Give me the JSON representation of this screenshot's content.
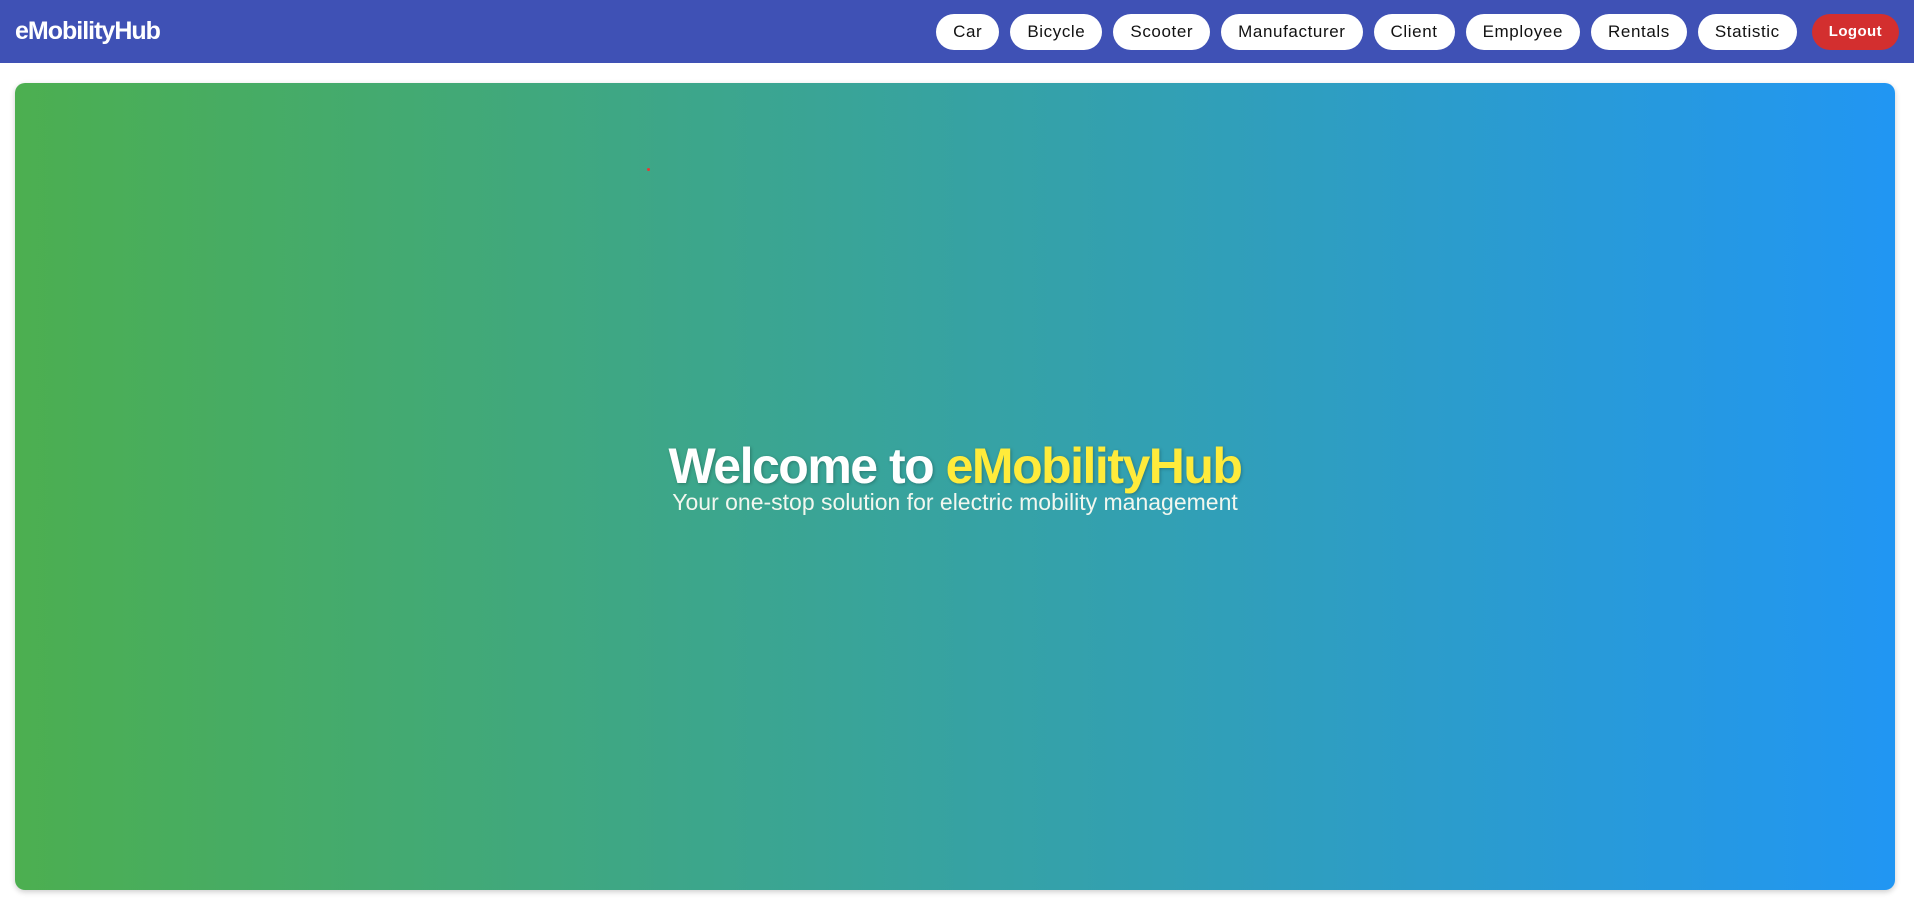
{
  "header": {
    "brand": "eMobilityHub",
    "nav_items": [
      "Car",
      "Bicycle",
      "Scooter",
      "Manufacturer",
      "Client",
      "Employee",
      "Rentals",
      "Statistic"
    ],
    "logout_label": "Logout"
  },
  "hero": {
    "title_prefix": "Welcome to ",
    "title_brand": "eMobilityHub",
    "subtitle": "Your one-stop solution for electric mobility management"
  },
  "colors": {
    "navbar": "#3f51b5",
    "gradient_start": "#4caf50",
    "gradient_end": "#2196f3",
    "brand_highlight": "#ffeb3b",
    "logout": "#d32f2f"
  }
}
